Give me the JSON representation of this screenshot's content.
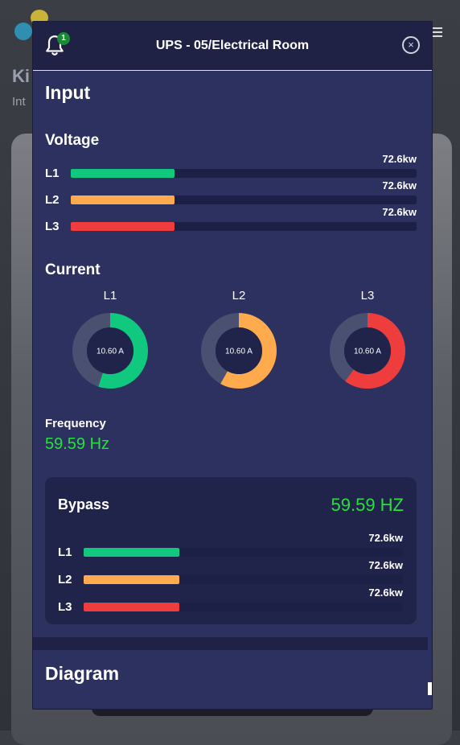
{
  "background": {
    "title": "Ki",
    "subtitle": "Int"
  },
  "modal": {
    "title": "UPS - 05/Electrical Room",
    "notifications_count": "1",
    "close_icon": "×"
  },
  "input": {
    "heading": "Input",
    "voltage": {
      "heading": "Voltage",
      "lines": [
        {
          "label": "L1",
          "value": "72.6kw",
          "fill": 0.3,
          "color": "#10c87e"
        },
        {
          "label": "L2",
          "value": "72.6kw",
          "fill": 0.3,
          "color": "#ffaa4c"
        },
        {
          "label": "L3",
          "value": "72.6kw",
          "fill": 0.3,
          "color": "#ef3d3d"
        }
      ]
    },
    "current": {
      "heading": "Current",
      "lines": [
        {
          "label": "L1",
          "value": "10.60 A",
          "fraction": 0.55,
          "color": "#10c87e"
        },
        {
          "label": "L2",
          "value": "10.60 A",
          "fraction": 0.58,
          "color": "#ffaa4c"
        },
        {
          "label": "L3",
          "value": "10.60 A",
          "fraction": 0.6,
          "color": "#ef3d3d"
        }
      ]
    },
    "frequency": {
      "label": "Frequency",
      "value": "59.59 Hz"
    }
  },
  "bypass": {
    "title": "Bypass",
    "value": "59.59 HZ",
    "lines": [
      {
        "label": "L1",
        "value": "72.6kw",
        "fill": 0.3,
        "color": "#10c87e"
      },
      {
        "label": "L2",
        "value": "72.6kw",
        "fill": 0.3,
        "color": "#ffaa4c"
      },
      {
        "label": "L3",
        "value": "72.6kw",
        "fill": 0.3,
        "color": "#ef3d3d"
      }
    ]
  },
  "diagram": {
    "heading": "Diagram"
  },
  "colors": {
    "accent_green": "#27e03c",
    "modal_bg": "#2c3160",
    "header_bg": "#1f2245"
  }
}
